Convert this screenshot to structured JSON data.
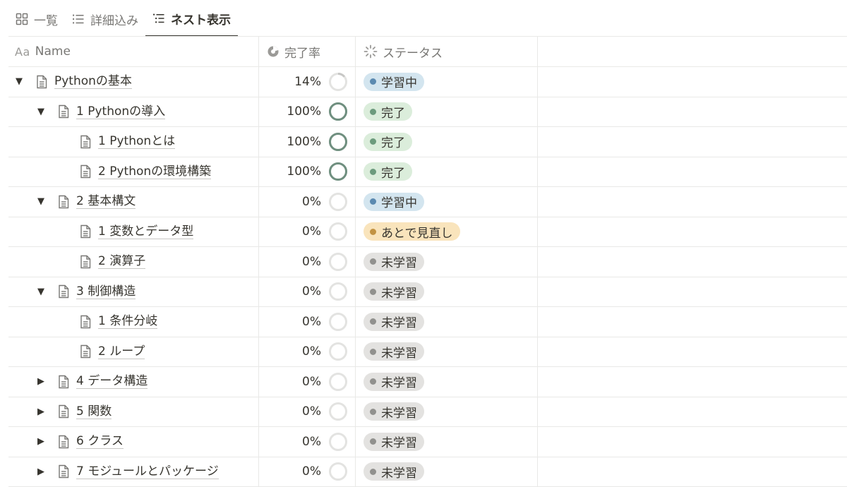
{
  "tabs": [
    {
      "label": "一覧",
      "icon": "grid-icon",
      "active": false
    },
    {
      "label": "詳細込み",
      "icon": "list-icon",
      "active": false
    },
    {
      "label": "ネスト表示",
      "icon": "nested-list-icon",
      "active": true
    }
  ],
  "columns": {
    "name_prefix": "Aa",
    "name": "Name",
    "progress": "完了率",
    "status": "ステータス"
  },
  "statuses": {
    "学習中": {
      "bg": "#d3e5ef",
      "dot": "#5b8ab0"
    },
    "完了": {
      "bg": "#dbeddb",
      "dot": "#6c9b7d"
    },
    "あとで見直し": {
      "bg": "#f9e4bc",
      "dot": "#c29343"
    },
    "未学習": {
      "bg": "#e3e2e0",
      "dot": "#91918e"
    }
  },
  "colors": {
    "ring_done": "#6f8f7f",
    "ring_partial": "#c7c7c5",
    "ring_track": "#e3e3e1"
  },
  "rows": [
    {
      "title": "Pythonの基本",
      "level": 0,
      "toggle": "expanded",
      "progress": 14,
      "progress_label": "14%",
      "status": "学習中"
    },
    {
      "title": "1 Pythonの導入",
      "level": 1,
      "toggle": "expanded",
      "progress": 100,
      "progress_label": "100%",
      "status": "完了"
    },
    {
      "title": "1 Pythonとは",
      "level": 2,
      "toggle": "none",
      "progress": 100,
      "progress_label": "100%",
      "status": "完了"
    },
    {
      "title": "2 Pythonの環境構築",
      "level": 2,
      "toggle": "none",
      "progress": 100,
      "progress_label": "100%",
      "status": "完了"
    },
    {
      "title": "2 基本構文",
      "level": 1,
      "toggle": "expanded",
      "progress": 0,
      "progress_label": "0%",
      "status": "学習中"
    },
    {
      "title": "1 変数とデータ型",
      "level": 2,
      "toggle": "none",
      "progress": 0,
      "progress_label": "0%",
      "status": "あとで見直し"
    },
    {
      "title": "2 演算子",
      "level": 2,
      "toggle": "none",
      "progress": 0,
      "progress_label": "0%",
      "status": "未学習"
    },
    {
      "title": "3 制御構造",
      "level": 1,
      "toggle": "expanded",
      "progress": 0,
      "progress_label": "0%",
      "status": "未学習"
    },
    {
      "title": "1 条件分岐",
      "level": 2,
      "toggle": "none",
      "progress": 0,
      "progress_label": "0%",
      "status": "未学習"
    },
    {
      "title": "2 ループ",
      "level": 2,
      "toggle": "none",
      "progress": 0,
      "progress_label": "0%",
      "status": "未学習"
    },
    {
      "title": "4 データ構造",
      "level": 1,
      "toggle": "collapsed",
      "progress": 0,
      "progress_label": "0%",
      "status": "未学習"
    },
    {
      "title": "5 関数",
      "level": 1,
      "toggle": "collapsed",
      "progress": 0,
      "progress_label": "0%",
      "status": "未学習"
    },
    {
      "title": "6 クラス",
      "level": 1,
      "toggle": "collapsed",
      "progress": 0,
      "progress_label": "0%",
      "status": "未学習"
    },
    {
      "title": "7 モジュールとパッケージ",
      "level": 1,
      "toggle": "collapsed",
      "progress": 0,
      "progress_label": "0%",
      "status": "未学習"
    }
  ]
}
